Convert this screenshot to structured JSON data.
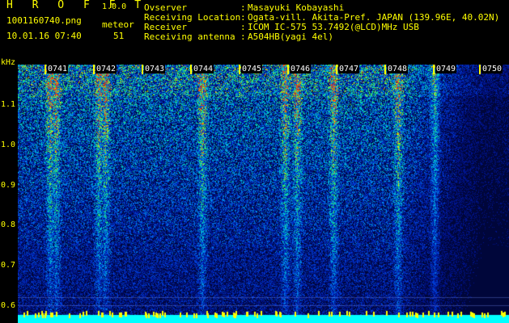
{
  "app": {
    "name": "H R O F F T",
    "version": "1.0.0"
  },
  "capture": {
    "file": "1001160740.png",
    "datetime": "10.01.16 07:40",
    "meteor_label": "meteor",
    "meteor_count": "51"
  },
  "info": [
    {
      "label": "Ovserver",
      "sep": ":",
      "value": "Masayuki Kobayashi"
    },
    {
      "label": "Receiving Location",
      "sep": ":",
      "value": "Ogata-vill. Akita-Pref. JAPAN (139.96E, 40.02N)"
    },
    {
      "label": "Receiver",
      "sep": ":",
      "value": "ICOM IC-575 53.7492(@LCD)MHz USB"
    },
    {
      "label": "Receiving antenna",
      "sep": ":",
      "value": "A504HB(yagi 4el)"
    }
  ],
  "spectrogram": {
    "y_unit": "kHz",
    "y_ticks": [
      "1.1",
      "1.0",
      "0.9",
      "0.8",
      "0.7",
      "0.6"
    ],
    "time_marks": [
      "0741",
      "0742",
      "0743",
      "0744",
      "0745",
      "0746",
      "0747",
      "0748",
      "0749",
      "0750"
    ],
    "colors": {
      "background": "#00063a",
      "label": "#ffff00",
      "baseline": "#00ffff"
    }
  }
}
